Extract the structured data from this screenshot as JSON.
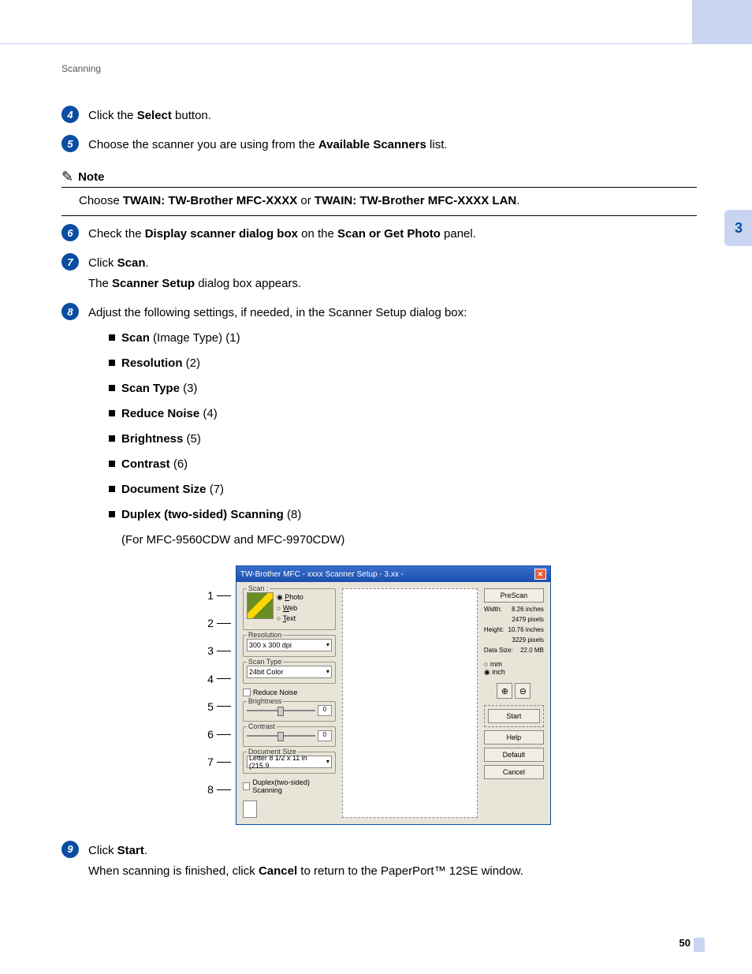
{
  "breadcrumb": "Scanning",
  "tab_number": "3",
  "page_number": "50",
  "steps": {
    "s4": {
      "num": "4",
      "text_a": "Click the ",
      "text_b": "Select",
      "text_c": " button."
    },
    "s5": {
      "num": "5",
      "text_a": "Choose the scanner you are using from the ",
      "text_b": "Available Scanners",
      "text_c": " list."
    },
    "s6": {
      "num": "6",
      "text_a": "Check the ",
      "text_b": "Display scanner dialog box",
      "text_c": " on the ",
      "text_d": "Scan or Get Photo",
      "text_e": " panel."
    },
    "s7": {
      "num": "7",
      "text_a": "Click ",
      "text_b": "Scan",
      "text_c": ".",
      "line2_a": "The ",
      "line2_b": "Scanner Setup",
      "line2_c": " dialog box appears."
    },
    "s8": {
      "num": "8",
      "text": "Adjust the following settings, if needed, in the Scanner Setup dialog box:"
    },
    "s9": {
      "num": "9",
      "text_a": "Click ",
      "text_b": "Start",
      "text_c": ".",
      "line2": "When scanning is finished, click ",
      "line2_b": "Cancel",
      "line2_c": " to return to the PaperPort™ 12SE window."
    }
  },
  "note": {
    "label": "Note",
    "text_a": "Choose ",
    "text_b": "TWAIN: TW-Brother MFC-XXXX",
    "text_c": " or ",
    "text_d": "TWAIN: TW-Brother MFC-XXXX LAN",
    "text_e": "."
  },
  "subs": [
    {
      "b": "Scan",
      "rest": " (Image Type) (1)"
    },
    {
      "b": "Resolution",
      "rest": " (2)"
    },
    {
      "b": "Scan Type",
      "rest": " (3)"
    },
    {
      "b": "Reduce Noise",
      "rest": " (4)"
    },
    {
      "b": "Brightness",
      "rest": " (5)"
    },
    {
      "b": "Contrast",
      "rest": " (6)"
    },
    {
      "b": "Document Size",
      "rest": " (7)"
    },
    {
      "b": "Duplex (two-sided) Scanning",
      "rest": " (8)"
    }
  ],
  "sub_note": "(For MFC-9560CDW and MFC-9970CDW)",
  "callouts": [
    "1",
    "2",
    "3",
    "4",
    "5",
    "6",
    "7",
    "8"
  ],
  "dialog": {
    "title": "TW-Brother MFC - xxxx      Scanner Setup - 3.xx  -",
    "scan_label": "Scan :",
    "photo": "Photo",
    "web": "Web",
    "text": "Text",
    "resolution_label": "Resolution",
    "resolution_val": "300 x 300 dpi",
    "scantype_label": "Scan Type",
    "scantype_val": "24bit Color",
    "reduce_noise": "Reduce Noise",
    "brightness_label": "Brightness",
    "brightness_val": "0",
    "contrast_label": "Contrast",
    "contrast_val": "0",
    "docsize_label": "Document Size",
    "docsize_val": "Letter 8 1/2 x 11 in (215.9 ",
    "duplex": "Duplex(two-sided) Scanning",
    "prescan": "PreScan",
    "width_l": "Width:",
    "width_v": "8.26 inches",
    "width_px": "2479 pixels",
    "height_l": "Height:",
    "height_v": "10.76 inches",
    "height_px": "3229 pixels",
    "datasize_l": "Data Size:",
    "datasize_v": "22.0 MB",
    "mm": "mm",
    "inch": "inch",
    "start_btn": "Start",
    "help_btn": "Help",
    "default_btn": "Default",
    "cancel_btn": "Cancel"
  }
}
